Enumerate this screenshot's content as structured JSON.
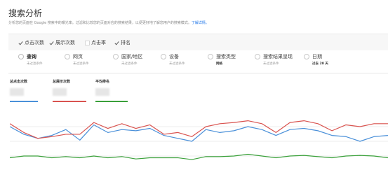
{
  "header": {
    "title": "搜索分析",
    "description": "分析您的页面在 Google 搜索中的曝光率。过滤和比较您的页面对应的搜索结果，以便更好地了解您用户的搜索模式。",
    "learn_more": "了解详情。"
  },
  "metrics": [
    {
      "label": "点击次数",
      "checked": true
    },
    {
      "label": "展示次数",
      "checked": true
    },
    {
      "label": "点击率",
      "checked": false
    },
    {
      "label": "排名",
      "checked": true
    }
  ],
  "dimensions": [
    {
      "label": "查询",
      "sub": "未过滤条件",
      "selected": true
    },
    {
      "label": "网页",
      "sub": "未过滤条件",
      "selected": false
    },
    {
      "label": "国家/地区",
      "sub": "未过滤条件",
      "selected": false
    },
    {
      "label": "设备",
      "sub": "未过滤条件",
      "selected": false
    },
    {
      "label": "搜索类型",
      "sub": "网络",
      "selected": false
    },
    {
      "label": "搜索结果呈现",
      "sub": "未过滤条件",
      "selected": false
    },
    {
      "label": "日期",
      "sub": "过去 28 天",
      "selected": false
    }
  ],
  "stats": [
    {
      "label": "总点击次数",
      "color": "#4a90d9"
    },
    {
      "label": "总展示次数",
      "color": "#d9534f"
    },
    {
      "label": "平均排名",
      "color": "#3aa03a"
    }
  ],
  "colors": {
    "clicks": "#4a90d9",
    "impressions": "#d9534f",
    "position": "#3aa03a",
    "grid": "#dddddd"
  },
  "chart_data": {
    "type": "line",
    "x": [
      1,
      2,
      3,
      4,
      5,
      6,
      7,
      8,
      9,
      10,
      11,
      12,
      13,
      14,
      15,
      16,
      17,
      18,
      19,
      20,
      21,
      22,
      23,
      24,
      25,
      26,
      27,
      28
    ],
    "series": [
      {
        "values": [
          75,
          62,
          55,
          60,
          70,
          52,
          78,
          65,
          70,
          68,
          72,
          60,
          55,
          50,
          70,
          65,
          68,
          75,
          70,
          60,
          70,
          72,
          68,
          60,
          58,
          50,
          58,
          60
        ]
      },
      {
        "values": [
          80,
          65,
          55,
          58,
          62,
          62,
          82,
          72,
          80,
          72,
          78,
          62,
          65,
          58,
          75,
          80,
          82,
          85,
          80,
          65,
          82,
          85,
          80,
          68,
          78,
          75,
          80,
          80
        ]
      },
      {
        "values": [
          22,
          25,
          25,
          22,
          24,
          22,
          25,
          22,
          24,
          20,
          22,
          22,
          22,
          19,
          24,
          24,
          25,
          28,
          25,
          22,
          25,
          26,
          24,
          22,
          25,
          26,
          25,
          22
        ]
      }
    ],
    "ylim": [
      0,
      100
    ],
    "grid": true
  }
}
